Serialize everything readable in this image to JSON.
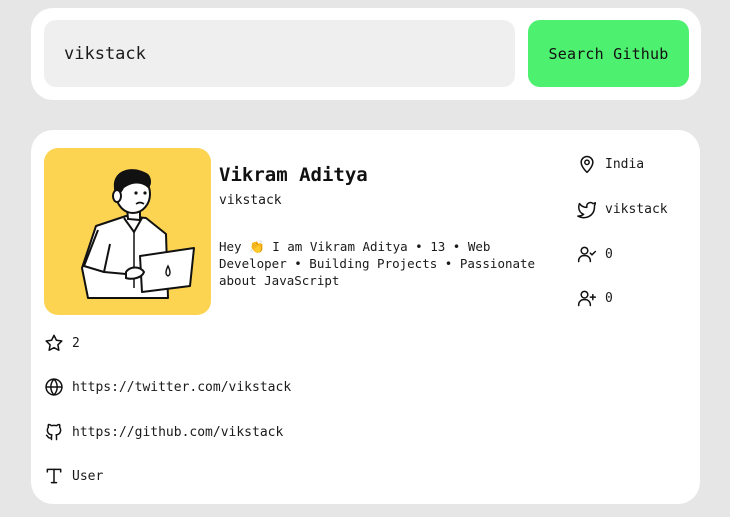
{
  "search": {
    "value": "vikstack",
    "button_label": "Search Github"
  },
  "profile": {
    "name": "Vikram Aditya",
    "login": "vikstack",
    "bio": "Hey 👏 I am Vikram Aditya • 13 • Web Developer • Building Projects • Passionate about JavaScript",
    "location": "India",
    "twitter": "vikstack",
    "following": "0",
    "followers": "0",
    "stars": "2",
    "website": "https://twitter.com/vikstack",
    "github_url": "https://github.com/vikstack",
    "type": "User"
  },
  "colors": {
    "accent": "#4ef06f",
    "avatar_bg": "#fdd451"
  },
  "icons": {
    "location": "map-pin-icon",
    "twitter": "twitter-icon",
    "following": "user-check-icon",
    "followers": "user-plus-icon",
    "stars": "star-icon",
    "website": "globe-icon",
    "github": "github-icon",
    "type": "type-icon"
  }
}
